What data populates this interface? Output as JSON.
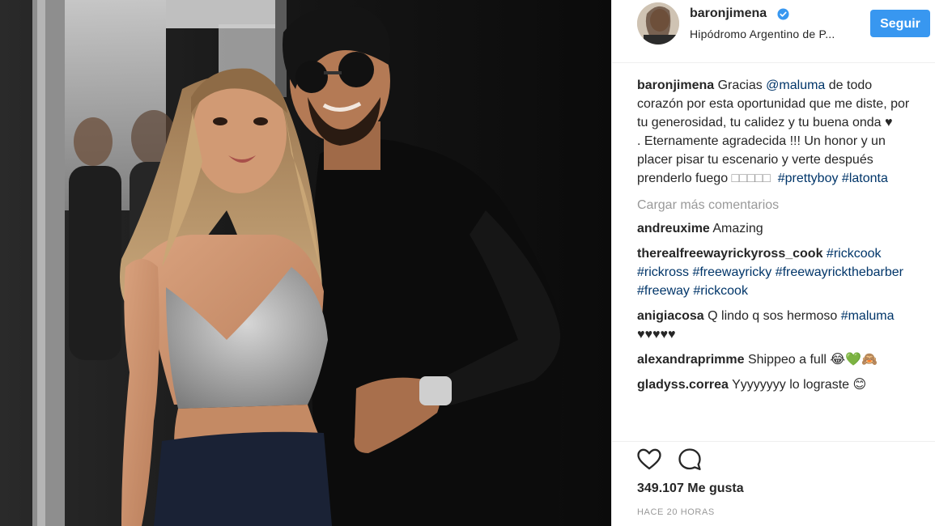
{
  "post": {
    "username": "baronjimena",
    "location": "Hipódromo Argentino de P...",
    "follow_label": "Seguir",
    "caption": {
      "username": "baronjimena",
      "lines": [
        {
          "text": "Gracias "
        },
        {
          "mention": "@maluma"
        },
        {
          "text": " de todo corazón por esta oportunidad que me diste, por tu generosidad, tu calidez y tu buena onda ♥"
        }
      ],
      "line2_text": ". Eternamente agradecida !!! Un honor y un placer pisar tu escenario y verte después prenderlo fuego ",
      "line2_boxes": "□□□□□",
      "hashtag1": "#prettyboy",
      "hashtag2": "#latonta"
    },
    "load_more": "Cargar más comentarios",
    "comments": [
      {
        "user": "andreuxime",
        "text": "Amazing"
      },
      {
        "user": "therealfreewayrickyross_cook",
        "hashtags": "#rickcook #rickross #freewayricky #freewayrickthebarber #freeway #rickcook"
      },
      {
        "user": "anigiacosa",
        "text": "Q lindo q sos hermoso ",
        "hashtag": "#maluma",
        "emoji": "♥♥♥♥♥"
      },
      {
        "user": "alexandraprimme",
        "text": "Shippeo a full 😂💚🙈"
      },
      {
        "user": "gladyss.correa",
        "text": "Yyyyyyyy lo lograste 😊"
      }
    ],
    "likes": "349.107 Me gusta",
    "timestamp": "HACE 20 HORAS",
    "icons": {
      "verified": "verified-badge-icon",
      "like": "heart-icon",
      "comment": "comment-bubble-icon"
    },
    "colors": {
      "accent": "#3897f0",
      "link": "#003569",
      "muted": "#999999"
    }
  }
}
